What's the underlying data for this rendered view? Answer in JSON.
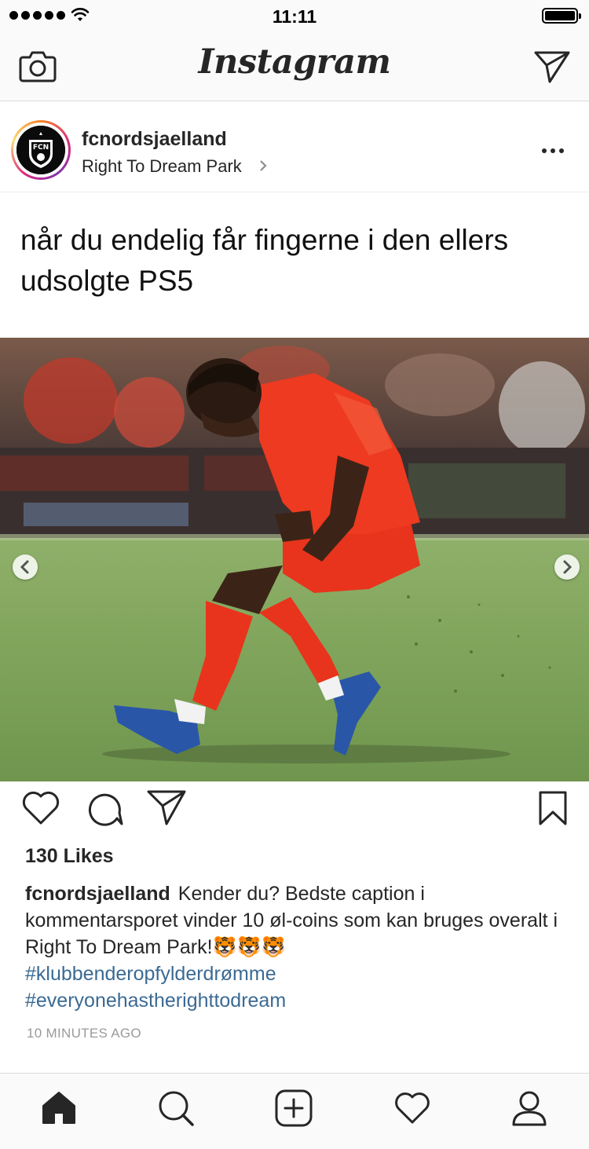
{
  "status_bar": {
    "time": "11:11"
  },
  "header": {
    "app_name": "Instagram"
  },
  "post": {
    "username": "fcnordsjaelland",
    "location": "Right To Dream Park",
    "headline": "når du endelig får fingerne i den ellers udsolgte PS5",
    "likes": "130 Likes",
    "caption_username": "fcnordsjaelland",
    "caption_text": "Kender du? Bedste caption i kommentarsporet vinder 10 øl-coins som kan bruges overalt i Right To Dream Park!🐯🐯🐯",
    "hashtags": [
      "#klubbenderopfylderdrømme",
      "#everyonehastherighttodream"
    ],
    "timestamp": "10 MINUTES AGO",
    "avatar_logo_text": "FCN"
  },
  "colors": {
    "hashtag": "#3b6a93",
    "kit_red": "#e8341c",
    "boot_blue": "#2a56a8"
  }
}
